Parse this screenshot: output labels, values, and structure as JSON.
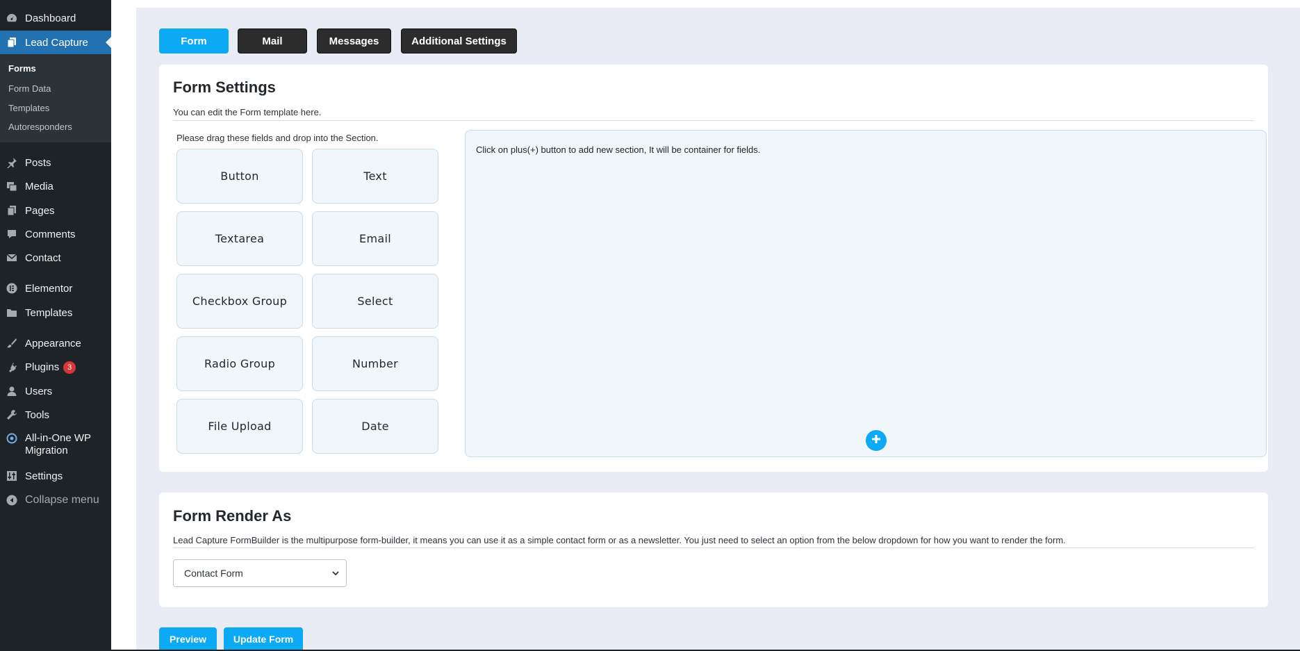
{
  "sidebar": {
    "items": [
      {
        "label": "Dashboard",
        "icon": "dashboard-icon"
      },
      {
        "label": "Lead Capture",
        "icon": "copy-icon"
      },
      {
        "label": "Posts",
        "icon": "pin-icon"
      },
      {
        "label": "Media",
        "icon": "media-icon"
      },
      {
        "label": "Pages",
        "icon": "pages-icon"
      },
      {
        "label": "Comments",
        "icon": "comment-icon"
      },
      {
        "label": "Contact",
        "icon": "mail-icon"
      },
      {
        "label": "Elementor",
        "icon": "elementor-icon"
      },
      {
        "label": "Templates",
        "icon": "folder-icon"
      },
      {
        "label": "Appearance",
        "icon": "brush-icon"
      },
      {
        "label": "Plugins",
        "icon": "plugin-icon",
        "badge": "3"
      },
      {
        "label": "Users",
        "icon": "user-icon"
      },
      {
        "label": "Tools",
        "icon": "wrench-icon"
      },
      {
        "label": "All-in-One WP",
        "label2": "Migration",
        "icon": "migration-icon"
      },
      {
        "label": "Settings",
        "icon": "settings-icon"
      },
      {
        "label": "Collapse menu",
        "icon": "collapse-icon"
      }
    ],
    "submenu": [
      "Forms",
      "Form Data",
      "Templates",
      "Autoresponders"
    ]
  },
  "tabs": [
    "Form",
    "Mail",
    "Messages",
    "Additional Settings"
  ],
  "form_settings": {
    "title": "Form Settings",
    "description": "You can edit the Form template here.",
    "hint": "Please drag these fields and drop into the Section.",
    "fields": [
      "Button",
      "Text",
      "Textarea",
      "Email",
      "Checkbox Group",
      "Select",
      "Radio Group",
      "Number",
      "File Upload",
      "Date"
    ],
    "dropzone_text": "Click on plus(+) button to add new section, It will be container for fields."
  },
  "render_as": {
    "title": "Form Render As",
    "description": "Lead Capture FormBuilder is the multipurpose form-builder, it means you can use it as a simple contact form or as a newsletter. You just need to select an option from the below dropdown for how you want to render the form.",
    "selected": "Contact Form"
  },
  "actions": {
    "preview": "Preview",
    "update": "Update Form"
  },
  "colors": {
    "accent": "#0ca9f5",
    "sidebar": "#1d2327",
    "active_menu": "#2271b1",
    "dark_tab": "#2c2c2c",
    "badge": "#d63638"
  }
}
